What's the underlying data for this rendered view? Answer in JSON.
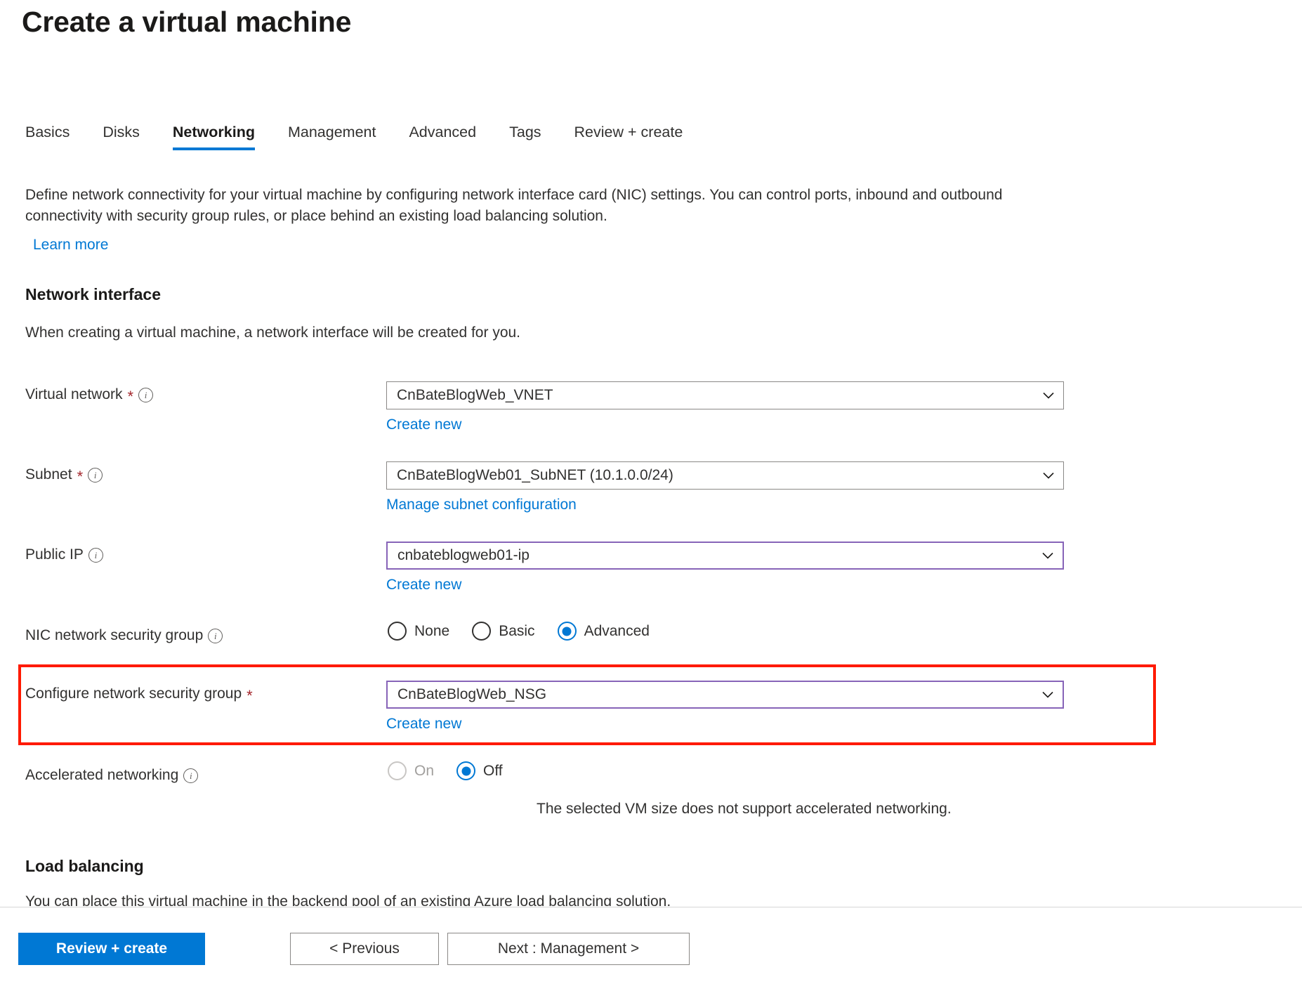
{
  "window": {
    "title": "Create a virtual machine"
  },
  "tabs": [
    {
      "label": "Basics",
      "active": false
    },
    {
      "label": "Disks",
      "active": false
    },
    {
      "label": "Networking",
      "active": true
    },
    {
      "label": "Management",
      "active": false
    },
    {
      "label": "Advanced",
      "active": false
    },
    {
      "label": "Tags",
      "active": false
    },
    {
      "label": "Review + create",
      "active": false
    }
  ],
  "intro": {
    "paragraph": "Define network connectivity for your virtual machine by configuring network interface card (NIC) settings. You can control ports, inbound and outbound connectivity with security group rules, or place behind an existing load balancing solution.",
    "learn_more": "Learn more"
  },
  "network_interface": {
    "heading": "Network interface",
    "subtext": "When creating a virtual machine, a network interface will be created for you.",
    "virtual_network": {
      "label": "Virtual network",
      "required": "*",
      "value": "CnBateBlogWeb_VNET",
      "action": "Create new"
    },
    "subnet": {
      "label": "Subnet",
      "required": "*",
      "value": "CnBateBlogWeb01_SubNET (10.1.0.0/24)",
      "action": "Manage subnet configuration"
    },
    "public_ip": {
      "label": "Public IP",
      "value": "cnbateblogweb01-ip",
      "action": "Create new"
    },
    "nic_nsg": {
      "label": "NIC network security group",
      "options": [
        "None",
        "Basic",
        "Advanced"
      ],
      "selected": "Advanced"
    },
    "configure_nsg": {
      "label": "Configure network security group",
      "required": "*",
      "value": "CnBateBlogWeb_NSG",
      "action": "Create new"
    },
    "accelerated_networking": {
      "label": "Accelerated networking",
      "options": [
        "On",
        "Off"
      ],
      "selected": "Off",
      "disabled_option": "On",
      "helper": "The selected VM size does not support accelerated networking."
    }
  },
  "load_balancing": {
    "heading": "Load balancing",
    "subtext": "You can place this virtual machine in the backend pool of an existing Azure load balancing solution."
  },
  "footer": {
    "review_create": "Review + create",
    "previous": "< Previous",
    "next": "Next : Management >"
  },
  "colors": {
    "accent": "#0078d4",
    "required": "#a4262c",
    "focus_border": "#8764b8",
    "annotation": "#ff1a00"
  }
}
